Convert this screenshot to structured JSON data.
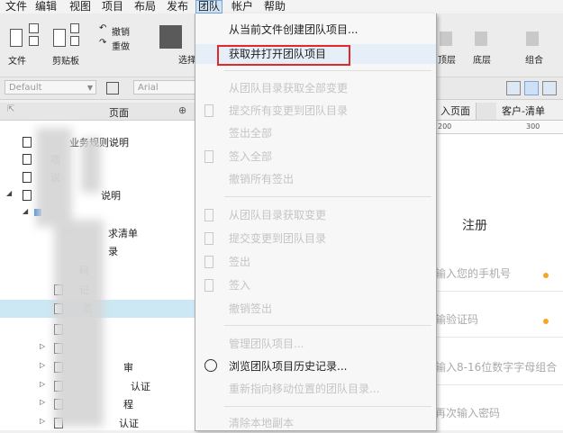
{
  "menubar": {
    "items": [
      "文件",
      "编辑",
      "视图",
      "项目",
      "布局",
      "发布",
      "团队",
      "帐户",
      "帮助"
    ]
  },
  "toolbar": {
    "file_label": "文件",
    "clipboard_label": "剪贴板",
    "undo_label": "撤销",
    "redo_label": "重做",
    "select_label": "选择",
    "top_label": "顶层",
    "bottom_label": "底层",
    "group_label": "组合"
  },
  "formatbar": {
    "style_value": "Default",
    "font_value": "Arial"
  },
  "pages_panel": {
    "title": "页面",
    "rows": [
      {
        "label": "业务规则说明"
      },
      {
        "label": "项"
      },
      {
        "label": "说"
      },
      {
        "label": "说明"
      },
      {
        "label": "求清单"
      },
      {
        "label": "录"
      },
      {
        "label": "码"
      },
      {
        "label": "记"
      },
      {
        "label": "页"
      },
      {
        "label": "审"
      },
      {
        "label": "程"
      },
      {
        "label": "认证"
      },
      {
        "label": "认证"
      }
    ]
  },
  "canvas": {
    "tabs": [
      "入页面",
      "客户-清单"
    ],
    "ruler": [
      "200",
      "300"
    ],
    "register_title": "注册",
    "fields": [
      "输入您的手机号",
      "输验证码",
      "输入8-16位数字字母组合",
      "再次输入密码"
    ]
  },
  "team_menu": {
    "items": [
      {
        "label": "从当前文件创建团队项目...",
        "enabled": true
      },
      {
        "label": "获取并打开团队项目",
        "enabled": true
      },
      {
        "label": "从团队目录获取全部变更",
        "enabled": false
      },
      {
        "label": "提交所有变更到团队目录",
        "enabled": false
      },
      {
        "label": "签出全部",
        "enabled": false
      },
      {
        "label": "签入全部",
        "enabled": false
      },
      {
        "label": "撤销所有签出",
        "enabled": false
      },
      {
        "label": "从团队目录获取变更",
        "enabled": false
      },
      {
        "label": "提交变更到团队目录",
        "enabled": false
      },
      {
        "label": "签出",
        "enabled": false
      },
      {
        "label": "签入",
        "enabled": false
      },
      {
        "label": "撤销签出",
        "enabled": false
      },
      {
        "label": "管理团队项目...",
        "enabled": false
      },
      {
        "label": "浏览团队项目历史记录...",
        "enabled": true
      },
      {
        "label": "重新指向移动位置的团队目录...",
        "enabled": false
      },
      {
        "label": "清除本地副本",
        "enabled": false
      }
    ]
  },
  "colors": {
    "highlight_box": "#e02a2a",
    "active_menu": "#cfe3f7",
    "connector_orange": "#f5a623"
  }
}
